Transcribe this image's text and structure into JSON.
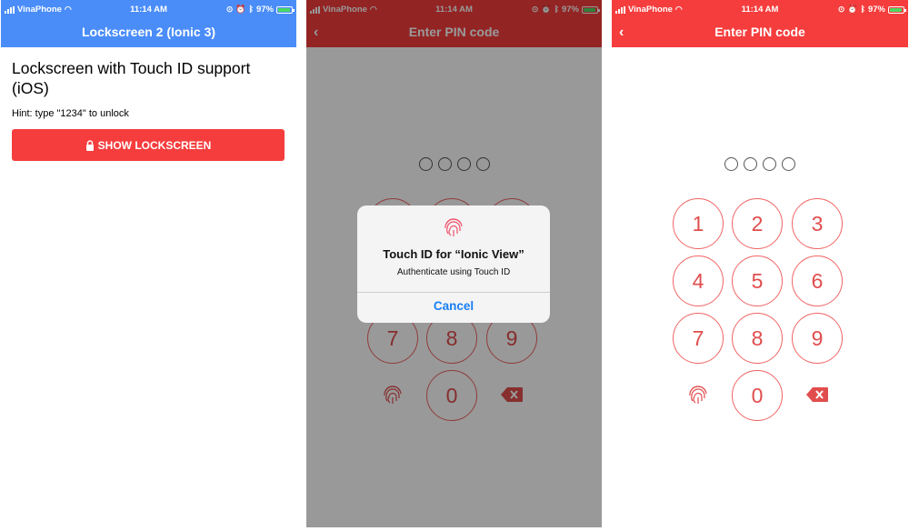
{
  "status_bar": {
    "carrier": "VinaPhone",
    "time": "11:14 AM",
    "battery": "97%"
  },
  "screen1": {
    "header_title": "Lockscreen 2 (Ionic 3)",
    "heading": "Lockscreen with Touch ID support (iOS)",
    "hint": "Hint: type \"1234\" to unlock",
    "button_label": "SHOW LOCKSCREEN"
  },
  "lockscreen": {
    "header_title": "Enter PIN code",
    "back_icon": "‹",
    "keys": [
      "1",
      "2",
      "3",
      "4",
      "5",
      "6",
      "7",
      "8",
      "9",
      "0"
    ],
    "pin_dots": 4
  },
  "touch_id_dialog": {
    "title": "Touch ID for “Ionic View”",
    "subtitle": "Authenticate using Touch ID",
    "cancel_label": "Cancel"
  },
  "colors": {
    "header_blue": "#4a8df8",
    "brand_red": "#f53d3d",
    "key_red": "#e14d4d",
    "ios_blue": "#1a7ff5"
  }
}
